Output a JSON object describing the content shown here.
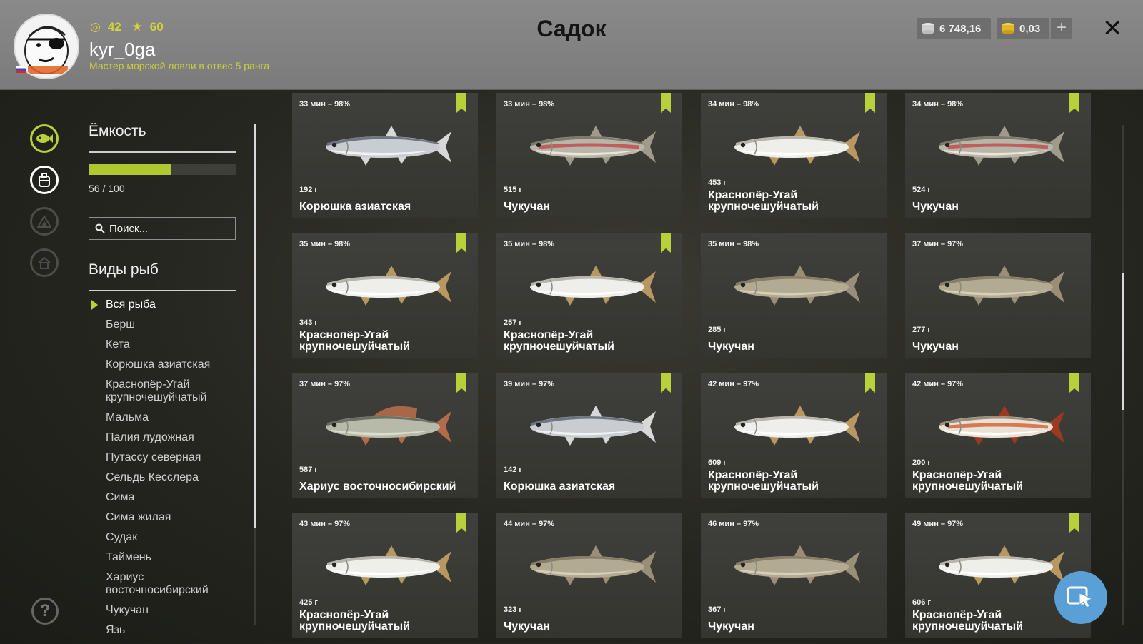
{
  "header": {
    "title": "Садок",
    "username": "kyr_0ga",
    "rank": "Мастер морской ловли в отвес 5 ранга",
    "level": "42",
    "stars": "60",
    "silver": "6 748,16",
    "gold": "0,03",
    "plus": "+",
    "close": "✕"
  },
  "sidebar": {
    "capacity_title": "Ёмкость",
    "capacity_value": "56 / 100",
    "capacity_fraction": 0.56,
    "search_placeholder": "Поиск...",
    "species_title": "Виды рыб",
    "species": [
      "Вся рыба",
      "Берш",
      "Кета",
      "Корюшка азиатская",
      "Краснопёр-Угай крупночешуйчатый",
      "Мальма",
      "Палия лудожная",
      "Путассу северная",
      "Сельдь Кесслера",
      "Сима",
      "Сима жилая",
      "Судак",
      "Таймень",
      "Хариус восточносибирский",
      "Чукучан",
      "Язь"
    ],
    "help": "?"
  },
  "cards": [
    {
      "time": "33 мин – 98%",
      "weight": "192 г",
      "name": "Корюшка азиатская",
      "bookmarked": true,
      "fish": "smelt"
    },
    {
      "time": "33 мин – 98%",
      "weight": "515 г",
      "name": "Чукучан",
      "bookmarked": true,
      "fish": "sucker-red"
    },
    {
      "time": "34 мин – 98%",
      "weight": "453 г",
      "name": "Краснопёр-Угай крупночешуйчатый",
      "bookmarked": true,
      "fish": "dace"
    },
    {
      "time": "34 мин – 98%",
      "weight": "524 г",
      "name": "Чукучан",
      "bookmarked": true,
      "fish": "sucker-red"
    },
    {
      "time": "35 мин – 98%",
      "weight": "343 г",
      "name": "Краснопёр-Угай крупночешуйчатый",
      "bookmarked": true,
      "fish": "dace"
    },
    {
      "time": "35 мин – 98%",
      "weight": "257 г",
      "name": "Краснопёр-Угай крупночешуйчатый",
      "bookmarked": true,
      "fish": "dace"
    },
    {
      "time": "35 мин – 98%",
      "weight": "285 г",
      "name": "Чукучан",
      "bookmarked": false,
      "fish": "sucker"
    },
    {
      "time": "37 мин – 97%",
      "weight": "277 г",
      "name": "Чукучан",
      "bookmarked": false,
      "fish": "sucker"
    },
    {
      "time": "37 мин – 97%",
      "weight": "587 г",
      "name": "Хариус восточносибирский",
      "bookmarked": true,
      "fish": "grayling"
    },
    {
      "time": "39 мин – 97%",
      "weight": "142 г",
      "name": "Корюшка азиатская",
      "bookmarked": true,
      "fish": "smelt"
    },
    {
      "time": "42 мин – 97%",
      "weight": "609 г",
      "name": "Краснопёр-Угай крупночешуйчатый",
      "bookmarked": true,
      "fish": "dace"
    },
    {
      "time": "42 мин – 97%",
      "weight": "200 г",
      "name": "Краснопёр-Угай крупночешуйчатый",
      "bookmarked": true,
      "fish": "dace-red"
    },
    {
      "time": "43 мин – 97%",
      "weight": "425 г",
      "name": "Краснопёр-Угай крупночешуйчатый",
      "bookmarked": true,
      "fish": "dace"
    },
    {
      "time": "44 мин – 97%",
      "weight": "323 г",
      "name": "Чукучан",
      "bookmarked": false,
      "fish": "sucker"
    },
    {
      "time": "46 мин – 97%",
      "weight": "367 г",
      "name": "Чукучан",
      "bookmarked": false,
      "fish": "sucker"
    },
    {
      "time": "49 мин – 97%",
      "weight": "606 г",
      "name": "Краснопёр-Угай крупночешуйчатый",
      "bookmarked": true,
      "fish": "dace"
    }
  ],
  "colors": {
    "accent": "#b8d13a",
    "header_bg": "#858585",
    "fab": "#5a9fd6"
  }
}
